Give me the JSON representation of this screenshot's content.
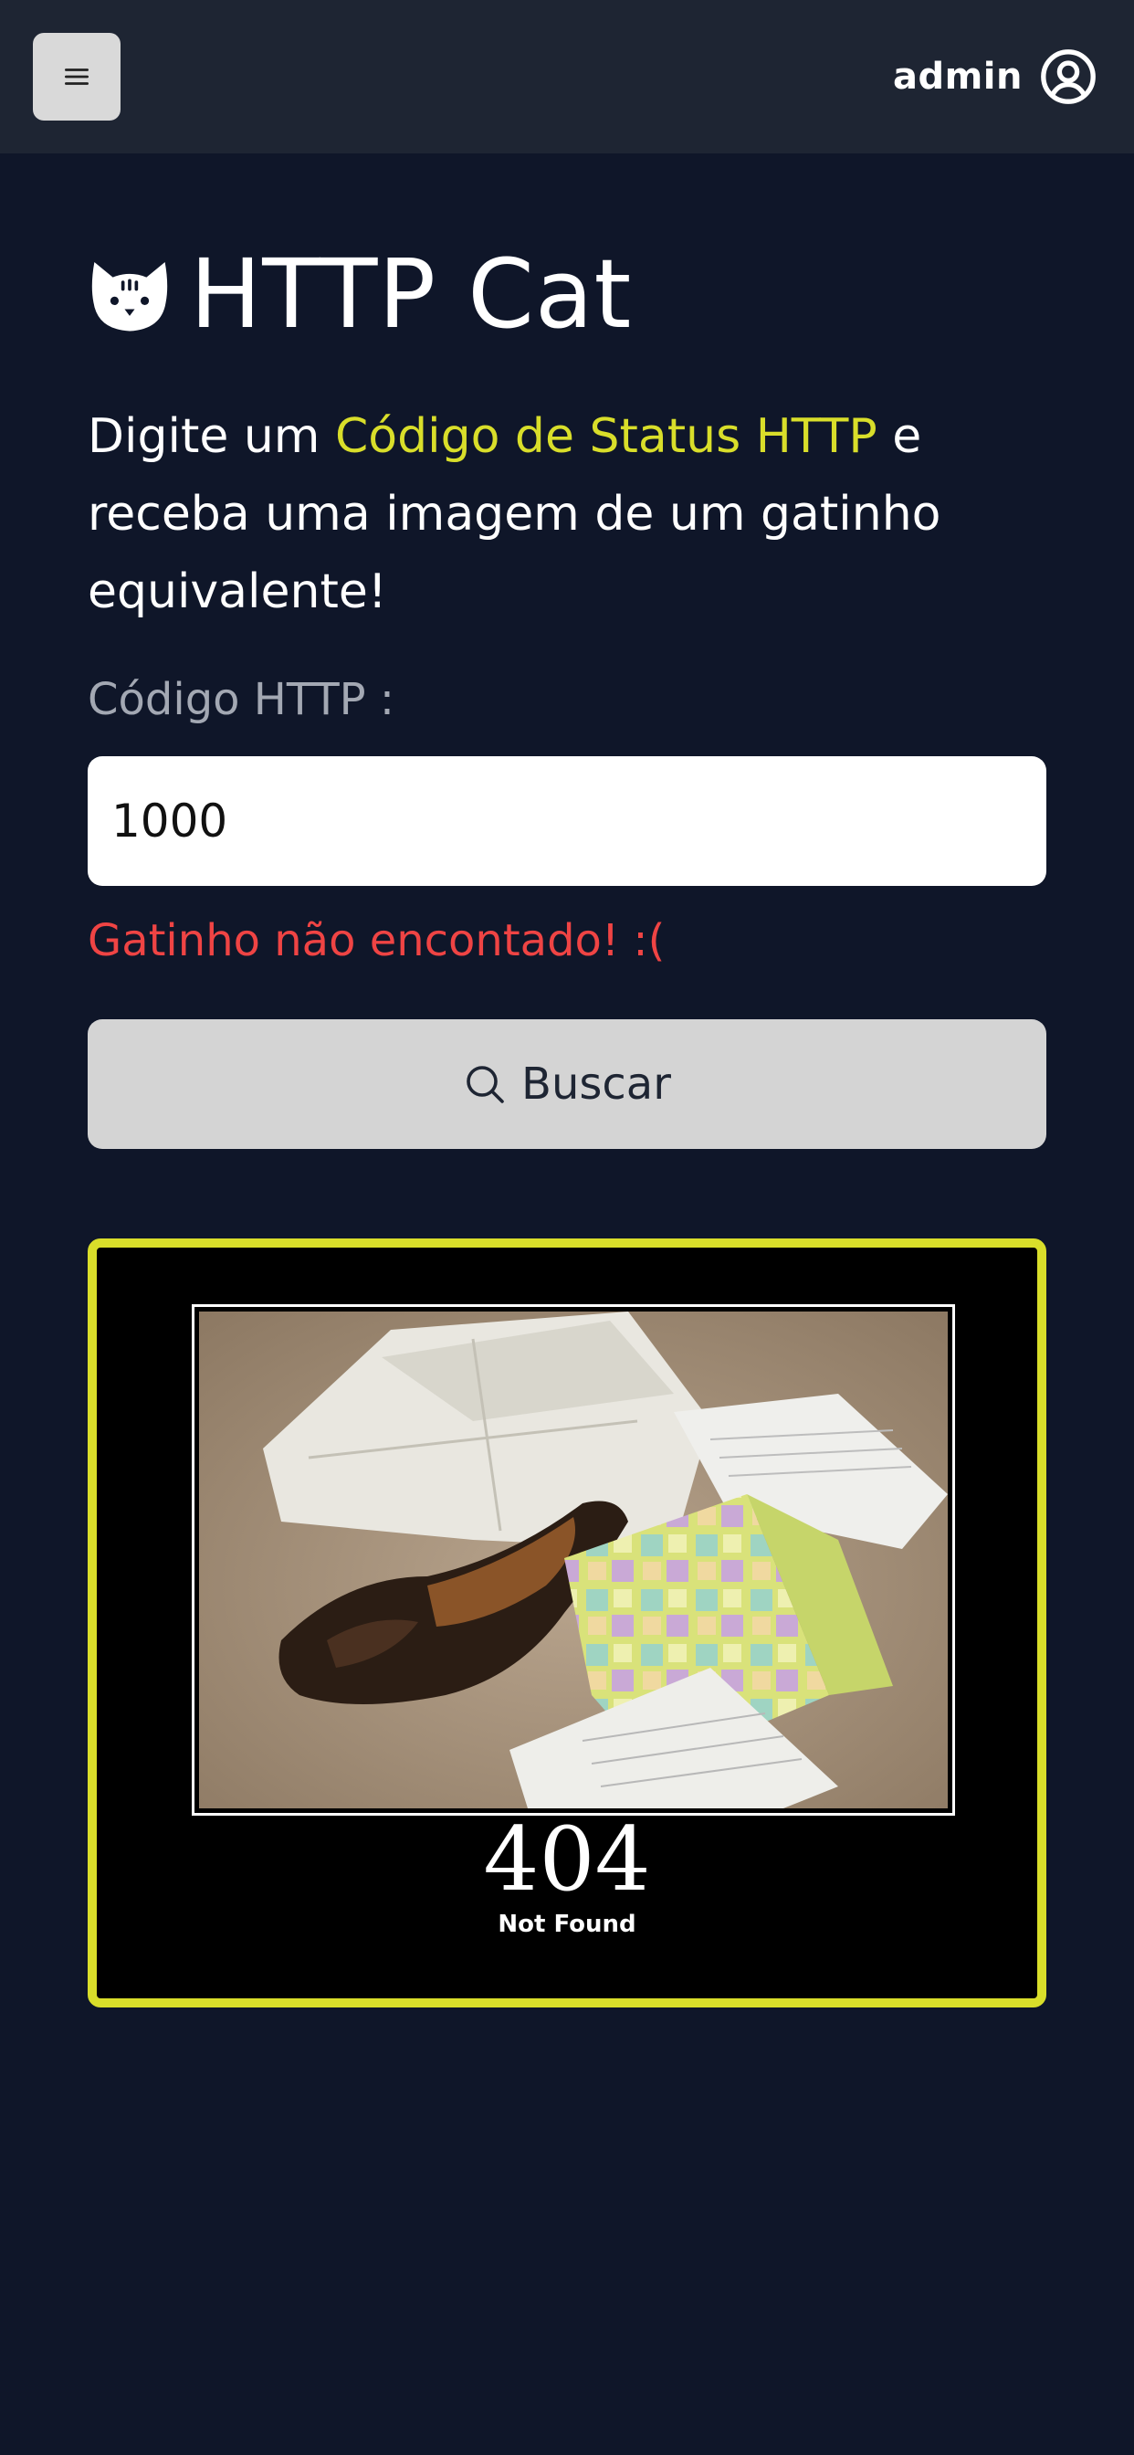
{
  "header": {
    "menu_icon": "hamburger-icon",
    "user_name": "admin",
    "user_icon": "user-circle-icon"
  },
  "main": {
    "logo_icon": "cat-face-icon",
    "title": "HTTP Cat",
    "intro_before": "Digite um ",
    "intro_highlight": "Código de Status HTTP",
    "intro_after": " e receba uma imagem de um gatinho equivalente!",
    "field_label": "Código HTTP :",
    "code_value": "1000",
    "error_text": "Gatinho não encontado! :(",
    "search_icon": "search-icon",
    "search_label": "Buscar"
  },
  "result": {
    "status_code": "404",
    "status_text": "Not Found"
  },
  "colors": {
    "background": "#0f1629",
    "header": "#1e2533",
    "accent": "#d9de2a",
    "error": "#ef4444",
    "button": "#d4d4d4"
  }
}
